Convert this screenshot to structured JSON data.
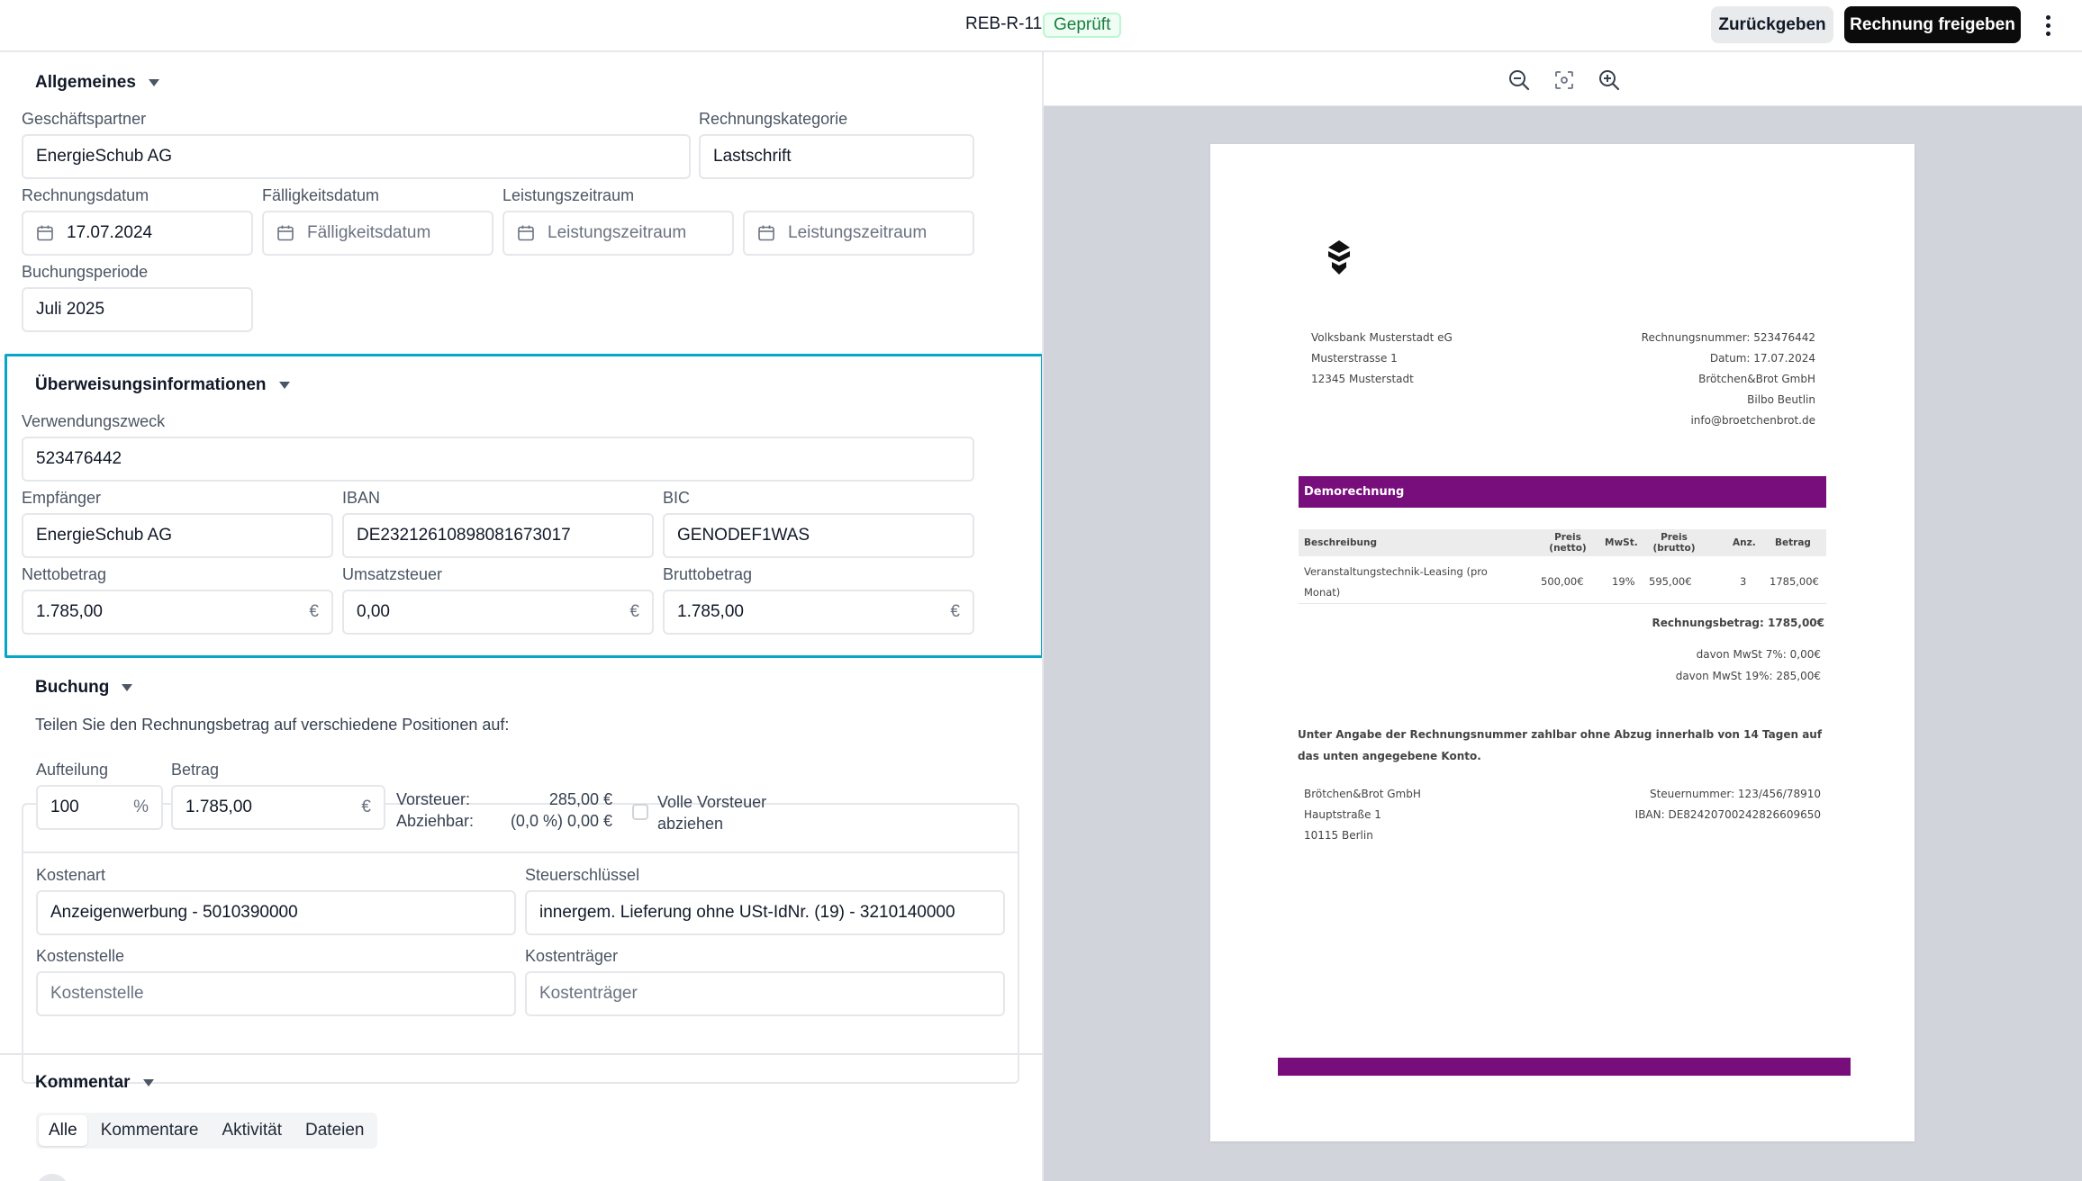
{
  "header": {
    "doc_id": "REB-R-11",
    "status": "Geprüft",
    "return_label": "Zurückgeben",
    "release_label": "Rechnung freigeben"
  },
  "general": {
    "title": "Allgemeines",
    "partner_label": "Geschäftspartner",
    "partner_value": "EnergieSchub AG",
    "category_label": "Rechnungskategorie",
    "category_value": "Lastschrift",
    "invoice_date_label": "Rechnungsdatum",
    "invoice_date_value": "17.07.2024",
    "due_date_label": "Fälligkeitsdatum",
    "due_date_placeholder": "Fälligkeitsdatum",
    "service_period_label": "Leistungszeitraum",
    "service_period_from_placeholder": "Leistungszeitraum",
    "service_period_to_placeholder": "Leistungszeitraum",
    "booking_period_label": "Buchungsperiode",
    "booking_period_value": "Juli 2025"
  },
  "transfer": {
    "title": "Überweisungsinformationen",
    "purpose_label": "Verwendungszweck",
    "purpose_value": "523476442",
    "recipient_label": "Empfänger",
    "recipient_value": "EnergieSchub AG",
    "iban_label": "IBAN",
    "iban_value": "DE23212610898081673017",
    "bic_label": "BIC",
    "bic_value": "GENODEF1WAS",
    "net_label": "Nettobetrag",
    "net_value": "1.785,00",
    "vat_label": "Umsatzsteuer",
    "vat_value": "0,00",
    "gross_label": "Bruttobetrag",
    "gross_value": "1.785,00",
    "currency": "€"
  },
  "booking": {
    "title": "Buchung",
    "description": "Teilen Sie den Rechnungsbetrag auf verschiedene Positionen auf:",
    "split_label": "Aufteilung",
    "split_value": "100",
    "split_unit": "%",
    "amount_label": "Betrag",
    "amount_value": "1.785,00",
    "amount_unit": "€",
    "input_tax_label": "Vorsteuer:",
    "input_tax_value": "285,00 €",
    "deductible_label": "Abziehbar:",
    "deductible_value": "(0,0 %) 0,00 €",
    "full_input_tax_line1": "Volle Vorsteuer",
    "full_input_tax_line2": "abziehen",
    "cost_type_label": "Kostenart",
    "cost_type_value": "Anzeigenwerbung - 5010390000",
    "tax_key_label": "Steuerschlüssel",
    "tax_key_value": "innergem. Lieferung ohne USt-IdNr. (19) - 3210140000",
    "cost_center_label": "Kostenstelle",
    "cost_center_placeholder": "Kostenstelle",
    "cost_unit_label": "Kostenträger",
    "cost_unit_placeholder": "Kostenträger"
  },
  "comments": {
    "title": "Kommentar",
    "tabs": [
      "Alle",
      "Kommentare",
      "Aktivität",
      "Dateien"
    ]
  },
  "viewer": {
    "icons": [
      "zoom-out-icon",
      "fit-screen-icon",
      "zoom-in-icon"
    ]
  },
  "invoice": {
    "sender": [
      "Volksbank Musterstadt eG",
      "Musterstrasse 1",
      "12345 Musterstadt"
    ],
    "meta": [
      "Rechnungsnummer: 523476442",
      "Datum: 17.07.2024",
      "Brötchen&Brot GmbH",
      "Bilbo Beutlin",
      "info@broetchenbrot.de"
    ],
    "banner": "Demorechnung",
    "columns": [
      "Beschreibung",
      "Preis (netto)",
      "MwSt.",
      "Preis (brutto)",
      "Anz.",
      "Betrag"
    ],
    "row": {
      "description_line1": "Veranstaltungstechnik-Leasing (pro",
      "description_line2": "Monat)",
      "net": "500,00€",
      "vat": "19%",
      "gross": "595,00€",
      "qty": "3",
      "amount": "1785,00€"
    },
    "total": "Rechnungsbetrag: 1785,00€",
    "vat7": "davon MwSt 7%: 0,00€",
    "vat19": "davon MwSt 19%: 285,00€",
    "payment_note_line1": "Unter Angabe der Rechnungsnummer zahlbar ohne Abzug innerhalb von 14 Tagen auf",
    "payment_note_line2": "das unten angegebene Konto.",
    "footer_left": [
      "Brötchen&Brot GmbH",
      "Hauptstraße 1",
      "10115 Berlin"
    ],
    "footer_right": [
      "Steuernummer: 123/456/78910",
      "IBAN: DE82420700242826609650"
    ],
    "brand_color": "#780d7c"
  },
  "colors": {
    "highlight": "#06a6c9",
    "status_green": "#15803d",
    "primary_button": "#0b0b0c"
  }
}
